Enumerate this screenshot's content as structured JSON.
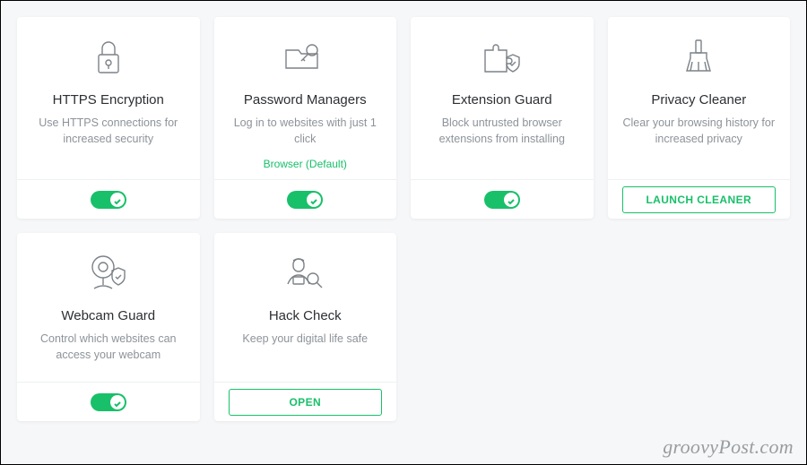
{
  "cards": [
    {
      "title": "HTTPS Encryption",
      "desc": "Use HTTPS connections for increased security",
      "extra": "",
      "action": {
        "type": "toggle",
        "label": ""
      }
    },
    {
      "title": "Password Managers",
      "desc": "Log in to websites with just 1 click",
      "extra": "Browser (Default)",
      "action": {
        "type": "toggle",
        "label": ""
      }
    },
    {
      "title": "Extension Guard",
      "desc": "Block untrusted browser extensions from installing",
      "extra": "",
      "action": {
        "type": "toggle",
        "label": ""
      }
    },
    {
      "title": "Privacy Cleaner",
      "desc": "Clear your browsing history for increased privacy",
      "extra": "",
      "action": {
        "type": "button",
        "label": "LAUNCH CLEANER"
      }
    },
    {
      "title": "Webcam Guard",
      "desc": "Control which websites can access your webcam",
      "extra": "",
      "action": {
        "type": "toggle",
        "label": ""
      }
    },
    {
      "title": "Hack Check",
      "desc": "Keep your digital life safe",
      "extra": "",
      "action": {
        "type": "button",
        "label": "OPEN"
      }
    }
  ],
  "watermark": "groovyPost.com"
}
